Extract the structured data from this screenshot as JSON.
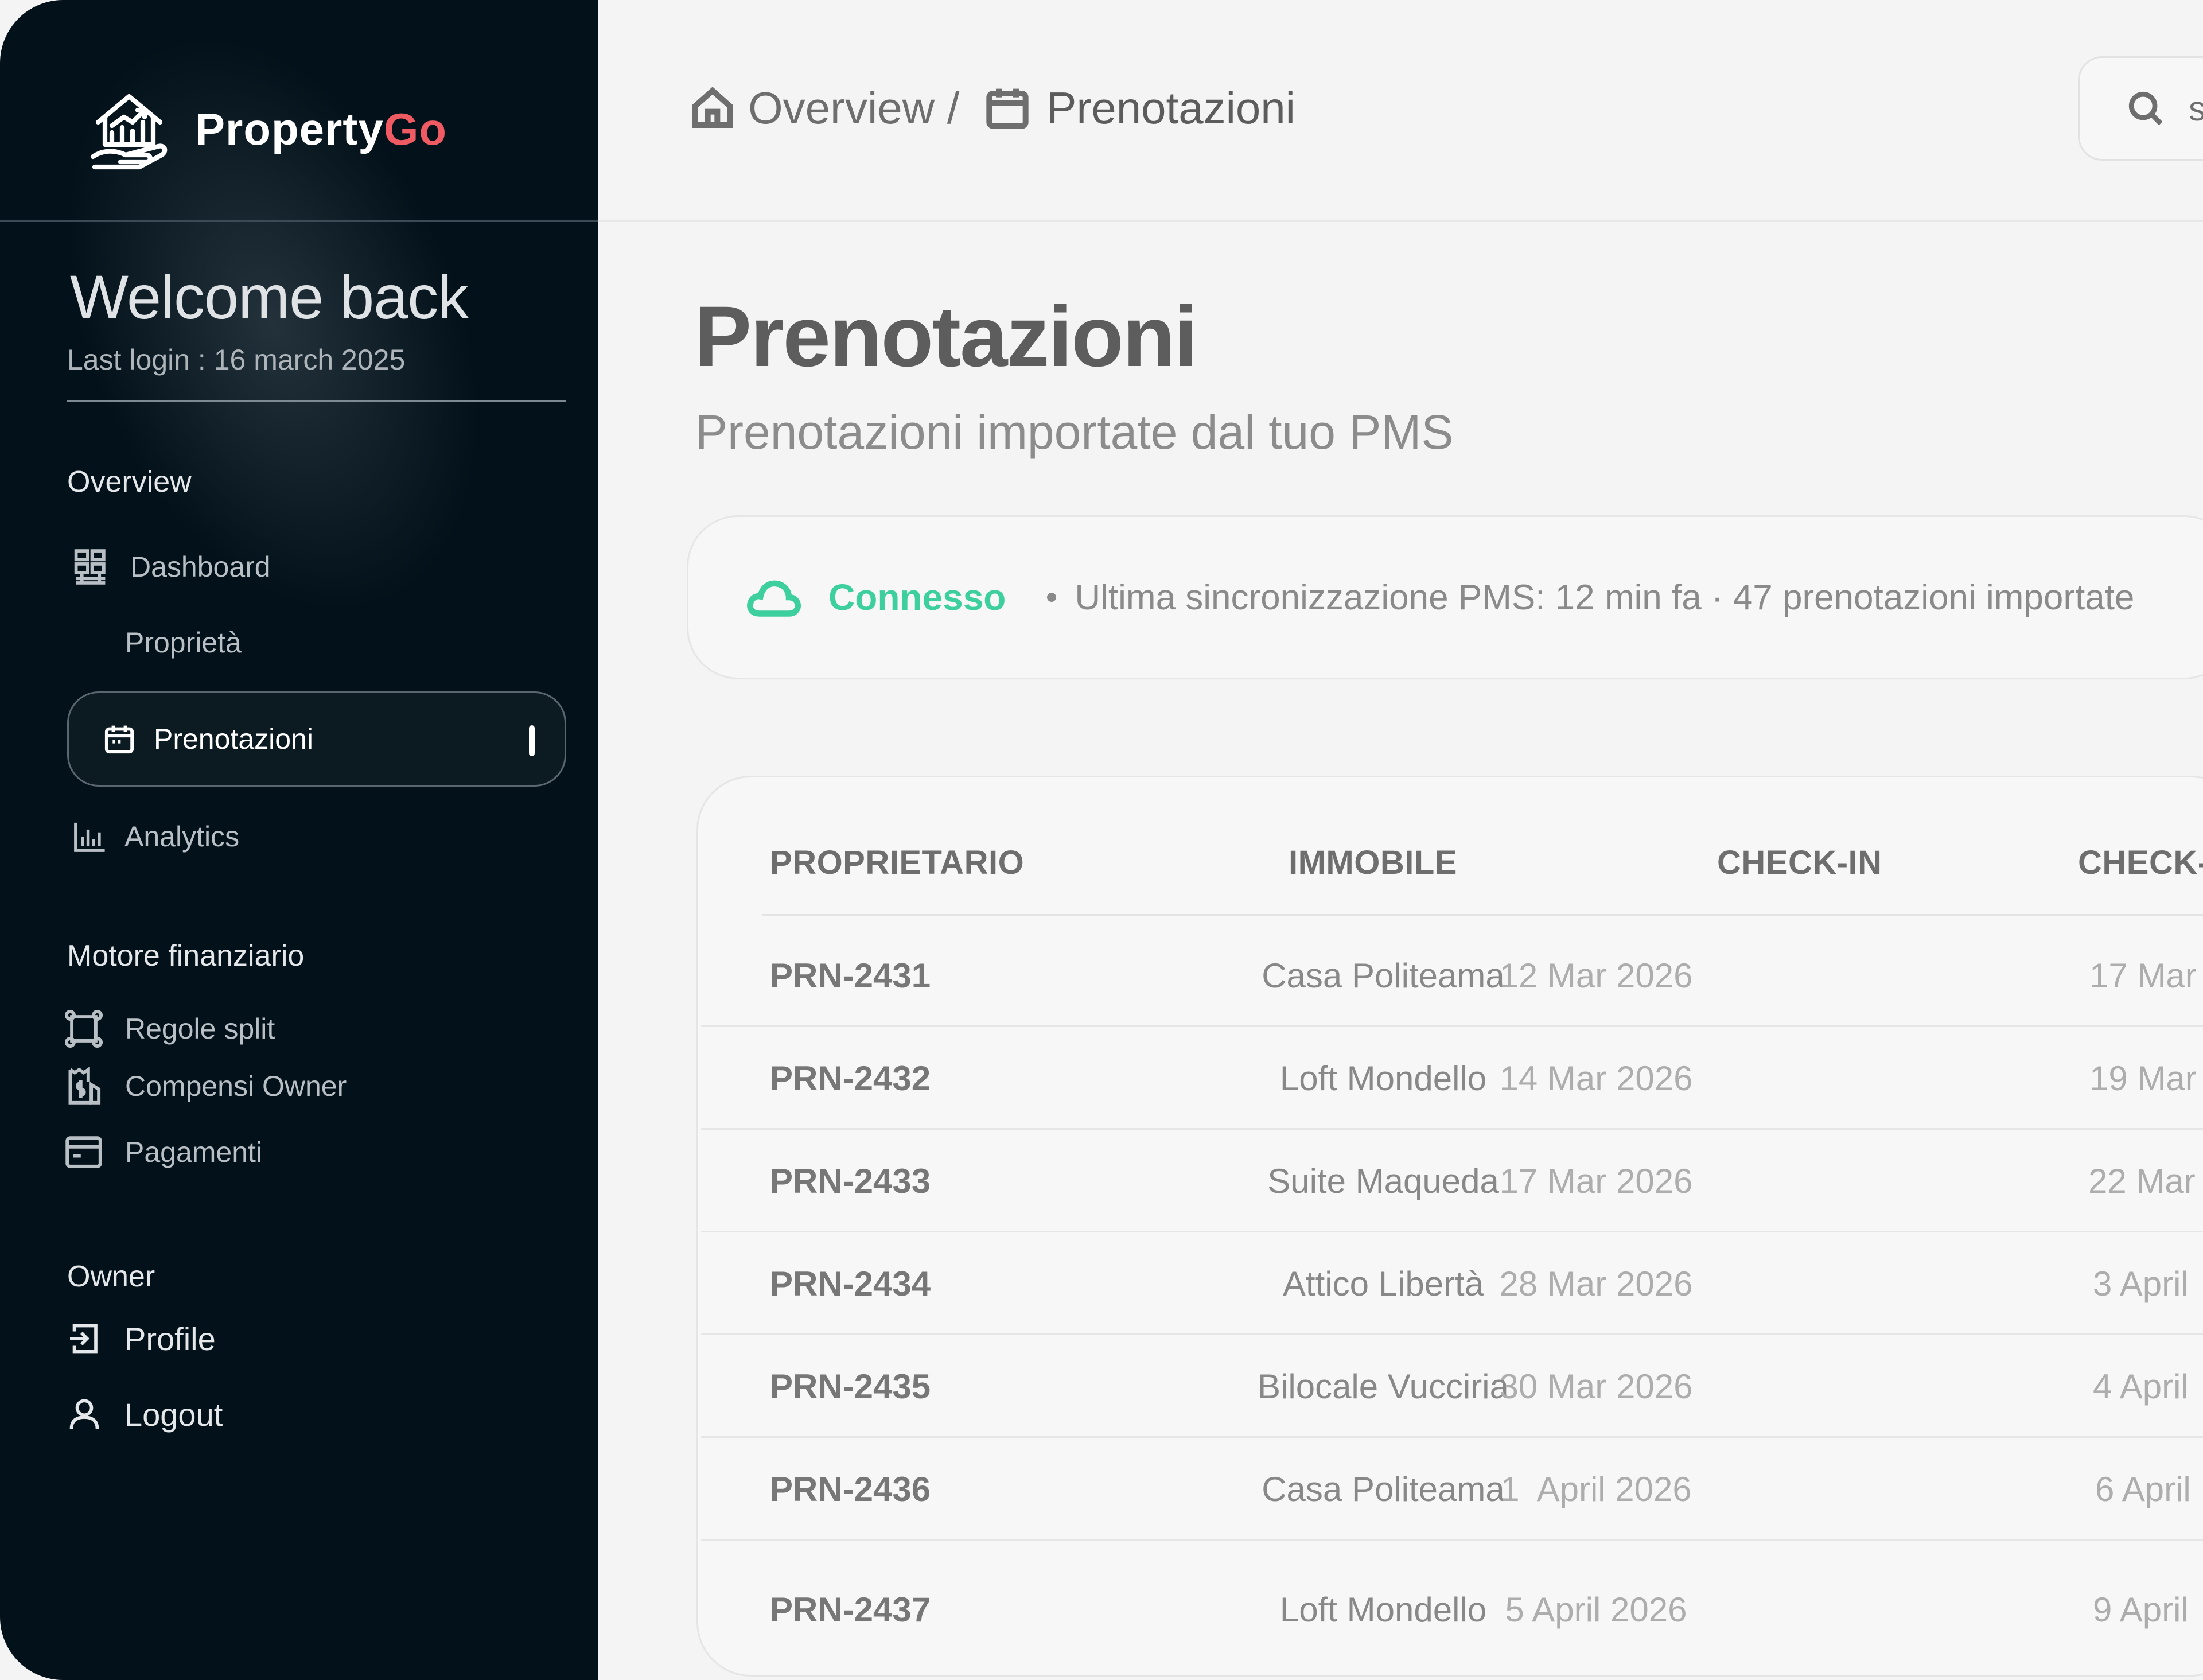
{
  "brand": {
    "name_main": "Property",
    "name_accent": "Go"
  },
  "welcome": {
    "title": "Welcome back",
    "last_login": "Last login : 16 march 2025"
  },
  "sidebar": {
    "sections": {
      "overview": "Overview",
      "finance": "Motore finanziario",
      "owner": "Owner"
    },
    "items": {
      "dashboard": "Dashboard",
      "properties": "Proprietà",
      "bookings": "Prenotazioni",
      "analytics": "Analytics",
      "split_rules": "Regole split",
      "owner_fees": "Compensi Owner",
      "payments": "Pagamenti",
      "profile": "Profile",
      "logout": "Logout"
    }
  },
  "header": {
    "breadcrumb_root": "Overview /",
    "breadcrumb_current": "Prenotazioni",
    "search_placeholder": "s"
  },
  "page": {
    "title": "Prenotazioni",
    "subtitle": "Prenotazioni importate dal tuo PMS"
  },
  "sync": {
    "status": "Connesso",
    "info": "Ultima sincronizzazione PMS: 12 min fa · 47 prenotazioni importate"
  },
  "table": {
    "headers": [
      "PROPRIETARIO",
      "IMMOBILE",
      "CHECK-IN",
      "CHECK-"
    ],
    "rows": [
      {
        "owner": "PRN-2431",
        "property": "Casa Politeama",
        "check_in": "12 Mar 2026",
        "check_out": "17 Mar"
      },
      {
        "owner": "PRN-2432",
        "property": "Loft Mondello",
        "check_in": "14 Mar 2026",
        "check_out": "19 Mar"
      },
      {
        "owner": "PRN-2433",
        "property": "Suite Maqueda",
        "check_in": "17 Mar 2026",
        "check_out": "22 Mar"
      },
      {
        "owner": "PRN-2434",
        "property": "Attico Libertà",
        "check_in": "28 Mar 2026",
        "check_out": "3 April"
      },
      {
        "owner": "PRN-2435",
        "property": "Bilocale Vucciria",
        "check_in": "30 Mar 2026",
        "check_out": "4 April"
      },
      {
        "owner": "PRN-2436",
        "property": "Casa Politeama",
        "check_in": "1  April 2026",
        "check_out": "6 April"
      },
      {
        "owner": "PRN-2437",
        "property": "Loft Mondello",
        "check_in": "5 April 2026",
        "check_out": "9 April"
      }
    ]
  },
  "colors": {
    "sidebar_bg": "#03111a",
    "brand_accent": "#ef5a63",
    "connected": "#3ecf9e",
    "main_bg": "#f4f4f4"
  },
  "icons": {
    "logo": "house-chart-hand-icon",
    "dashboard": "dashboard-grid-icon",
    "bookings": "calendar-icon",
    "analytics": "bar-chart-icon",
    "split_rules": "split-frame-icon",
    "owner_fees": "receipt-dollar-icon",
    "payments": "credit-card-icon",
    "profile": "login-arrow-icon",
    "logout": "user-icon",
    "breadcrumb_root": "home-icon",
    "breadcrumb_current": "calendar-icon",
    "search": "search-icon",
    "sync": "cloud-icon"
  }
}
